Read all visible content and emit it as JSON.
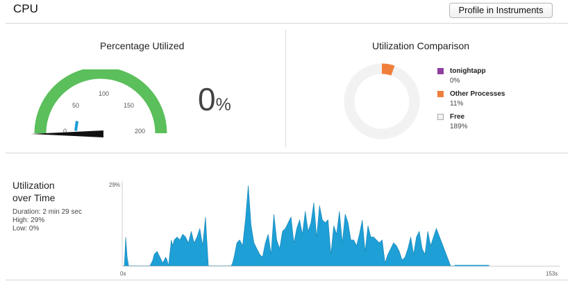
{
  "header": {
    "title": "CPU",
    "profile_button": "Profile in Instruments"
  },
  "gauge": {
    "title": "Percentage Utilized",
    "ticks": [
      "0",
      "50",
      "100",
      "150",
      "200"
    ],
    "value_percent": 0,
    "value_text": "0",
    "unit": "%",
    "arc_color": "#5bbf5b",
    "needle_color": "#111111",
    "indicator_color": "#1e9fd6"
  },
  "comparison": {
    "title": "Utilization Comparison",
    "legend": [
      {
        "name": "tonightapp",
        "value": "0%",
        "color": "#8e3fa0"
      },
      {
        "name": "Other Processes",
        "value": "11%",
        "color": "#f07f3c"
      },
      {
        "name": "Free",
        "value": "189%",
        "color": "#f2f2f2"
      }
    ],
    "donut_total": 200,
    "donut_values": [
      0,
      11,
      189
    ]
  },
  "over_time": {
    "title_line1": "Utilization",
    "title_line2": "over Time",
    "duration": "Duration: 2 min 29 sec",
    "high": "High: 29%",
    "low": "Low: 0%"
  },
  "chart_data": {
    "type": "area",
    "ylabel_max": "29%",
    "x_start_label": "0s",
    "x_end_label": "153s",
    "xlim": [
      0,
      153
    ],
    "ylim": [
      0,
      29
    ],
    "color": "#1e9fd6",
    "x": [
      0,
      0.5,
      1.0,
      1.5,
      2.0,
      4.0,
      6.0,
      8.0,
      9.5,
      10.5,
      11.0,
      12.0,
      13.0,
      14.0,
      15.0,
      15.5,
      16.0,
      17.0,
      17.5,
      18.0,
      19.0,
      20.0,
      21.0,
      22.0,
      23.0,
      24.0,
      25.0,
      26.0,
      27.0,
      28.0,
      29.0,
      30.0,
      32.0,
      34.0,
      36.0,
      38.0,
      38.5,
      39.0,
      40.0,
      41.0,
      42.0,
      43.0,
      44.0,
      45.0,
      46.0,
      47.0,
      48.0,
      49.0,
      50.0,
      51.0,
      52.0,
      53.0,
      54.0,
      55.0,
      56.0,
      57.0,
      58.0,
      59.0,
      60.0,
      61.0,
      62.0,
      63.0,
      64.0,
      65.0,
      66.0,
      67.0,
      68.0,
      69.0,
      70.0,
      71.0,
      72.0,
      73.0,
      74.0,
      75.0,
      76.0,
      77.0,
      78.0,
      79.0,
      80.0,
      81.0,
      82.0,
      83.0,
      84.0,
      85.0,
      86.0,
      87.0,
      88.0,
      89.0,
      90.0,
      91.0,
      92.0,
      93.0,
      94.0,
      95.0,
      96.0,
      97.0,
      98.0,
      99.0,
      100.0,
      101.0,
      102.0,
      103.0,
      104.0,
      105.0,
      106.0,
      107.0,
      108.0,
      110.0,
      115.0,
      120.0,
      125.0,
      128.0,
      128.5,
      153.0
    ],
    "values": [
      0,
      0,
      10,
      3,
      0,
      0,
      0,
      0,
      0,
      2,
      4,
      5,
      3,
      1,
      3,
      2,
      0,
      9,
      7,
      9,
      10,
      9,
      11,
      10,
      8,
      12,
      8,
      10,
      13,
      7,
      17,
      0,
      0,
      0,
      0,
      0,
      1,
      3,
      8,
      9,
      7,
      16,
      28,
      14,
      8,
      6,
      4,
      3,
      8,
      11,
      4,
      18,
      9,
      6,
      12,
      13,
      15,
      17,
      8,
      13,
      16,
      11,
      19,
      12,
      15,
      22,
      10,
      21,
      16,
      15,
      16,
      4,
      14,
      11,
      19,
      8,
      18,
      15,
      9,
      9,
      7,
      11,
      16,
      5,
      14,
      10,
      10,
      9,
      8,
      9,
      1,
      4,
      6,
      8,
      7,
      5,
      2,
      3,
      6,
      10,
      4,
      10,
      12,
      6,
      4,
      12,
      7,
      13,
      0,
      0,
      0,
      0,
      0,
      0,
      0,
      0
    ],
    "baseline_x_end": 128.5
  }
}
